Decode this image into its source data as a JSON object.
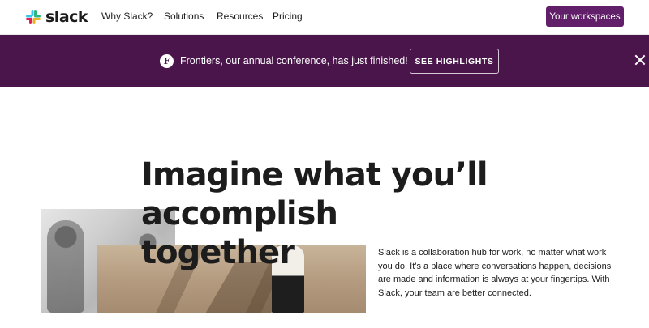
{
  "brand": {
    "name": "slack",
    "colors": {
      "aubergine": "#4a154b",
      "button_purple": "#611f69",
      "logo_blue": "#36c5f0",
      "logo_green": "#2eb67d",
      "logo_yellow": "#ecb22e",
      "logo_red": "#e01e5a"
    }
  },
  "nav": {
    "links": [
      "Why Slack?",
      "Solutions",
      "Resources",
      "Pricing"
    ],
    "cta_label": "Your workspaces"
  },
  "banner": {
    "icon": "frontiers-f-icon",
    "icon_glyph": "F",
    "message": "Frontiers, our annual conference, has just finished!",
    "button_label": "SEE HIGHLIGHTS",
    "close_icon": "close-icon"
  },
  "hero": {
    "title": "Imagine what you’ll accomplish together",
    "description": "Slack is a collaboration hub for work, no matter what work you do. It’s a place where conversations happen, decisions are made and information is always at your fingertips. With Slack, your team are better connected."
  }
}
